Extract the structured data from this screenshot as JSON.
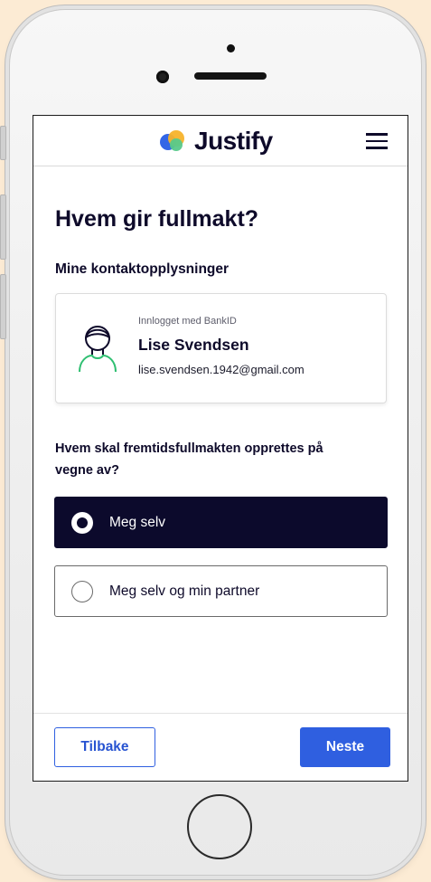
{
  "brand": {
    "name": "Justify",
    "logo_colors": [
      "#3366e6",
      "#f7b32b",
      "#59c98b"
    ],
    "text_color": "#0e0a2a"
  },
  "header": {
    "menu_icon": "hamburger-menu-icon"
  },
  "page": {
    "title": "Hvem gir fullmakt?",
    "contact_section_label": "Mine kontaktopplysninger"
  },
  "contact": {
    "caption": "Innlogget med BankID",
    "name": "Lise Svendsen",
    "email": "lise.svendsen.1942@gmail.com",
    "avatar_icon": "user-avatar-icon",
    "avatar_accent": "#2fbf71"
  },
  "question": {
    "text": "Hvem skal fremtidsfullmakten opprettes på vegne av?",
    "options": [
      {
        "label": "Meg selv",
        "selected": true
      },
      {
        "label": "Meg selv og min partner",
        "selected": false
      }
    ]
  },
  "footer": {
    "back_label": "Tilbake",
    "next_label": "Neste",
    "primary_color": "#2f5fe0"
  }
}
